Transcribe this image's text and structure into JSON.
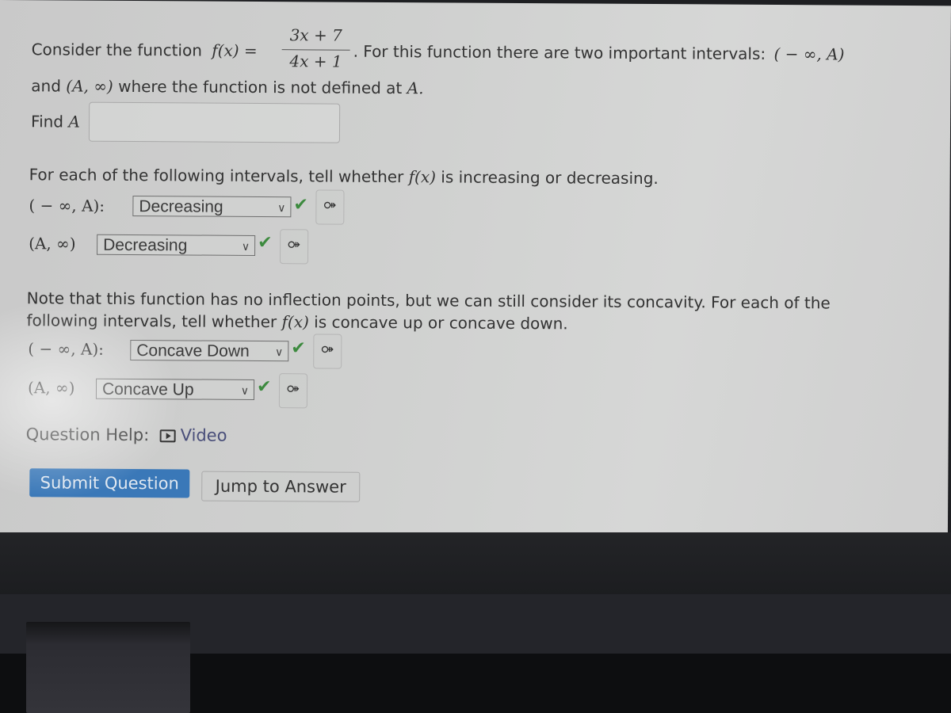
{
  "question": {
    "intro_prefix": "Consider the function",
    "function_name": "f(x) =",
    "numerator": "3x + 7",
    "denominator": "4x + 1",
    "intro_suffix": ". For this function there are two important intervals:",
    "interval_left": "( − ∞, A)",
    "line2_prefix": "and",
    "interval_right": "(A, ∞)",
    "line2_suffix": "where the function is not defined at",
    "line2_var": "A.",
    "find_label": "Find",
    "find_var": "A",
    "find_input_value": ""
  },
  "monotonicity": {
    "prompt_prefix": "For each of the following intervals, tell whether",
    "prompt_func": "f(x)",
    "prompt_suffix": "is increasing or decreasing.",
    "rows": [
      {
        "interval": "( − ∞, A):",
        "selected": "Decreasing",
        "status": "✔",
        "key_icon": "⚩"
      },
      {
        "interval": "(A, ∞)",
        "selected": "Decreasing",
        "status": "✔",
        "key_icon": "⚩"
      }
    ]
  },
  "concavity": {
    "note_line1": "Note that this function has no inflection points, but we can still consider its concavity. For each of the",
    "note_line2_prefix": "following intervals, tell whether",
    "note_func": "f(x)",
    "note_line2_suffix": "is concave up or concave down.",
    "rows": [
      {
        "interval": "( − ∞, A):",
        "selected": "Concave Down",
        "status": "✔",
        "key_icon": "⚩"
      },
      {
        "interval": "(A, ∞)",
        "selected": "Concave Up",
        "status": "✔",
        "key_icon": "⚩"
      }
    ]
  },
  "help": {
    "label": "Question Help:",
    "video_label": "Video"
  },
  "actions": {
    "submit_label": "Submit Question",
    "jump_label": "Jump to Answer"
  },
  "colors": {
    "submit_bg": "#3a78b8",
    "check_green": "#3c8a3e",
    "link": "#4a4f7a"
  }
}
